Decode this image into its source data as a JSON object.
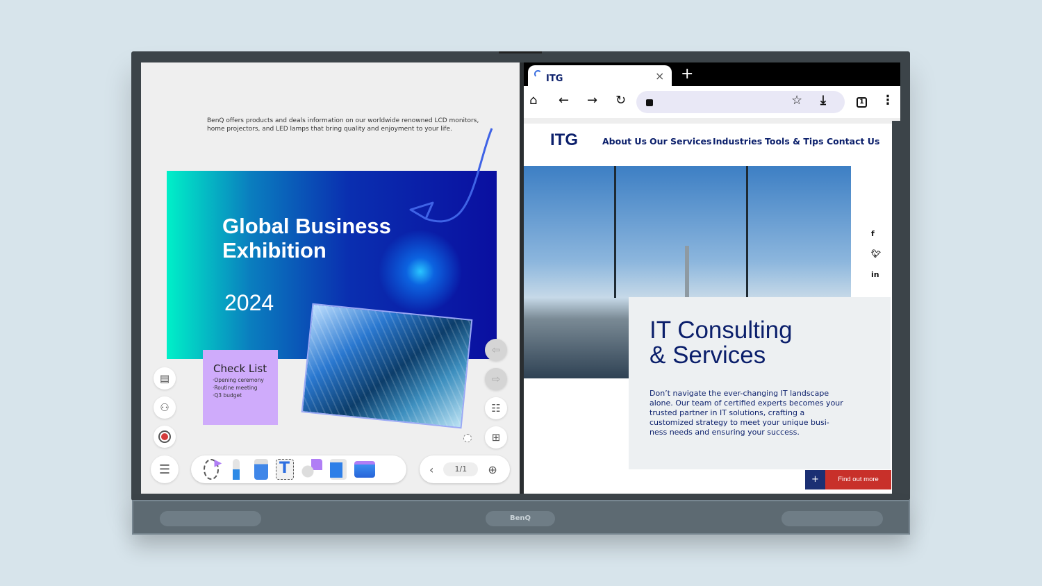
{
  "device": {
    "brand": "BenQ"
  },
  "whiteboard": {
    "intro": "BenQ offers products and deals information on our worldwide renowned LCD monitors, home projectors, and LED lamps that bring quality and enjoyment to your life.",
    "banner_title": "Global Business Exhibition",
    "banner_year": "2024",
    "sticky_title": "Check List",
    "sticky_items": [
      "·Opening ceremony",
      "·Routine meeting",
      "·Q3 budget"
    ],
    "page_indicator": "1/1",
    "left_icons": [
      "clipboard-icon",
      "add-user-icon",
      "record-icon"
    ],
    "right_icons": [
      "undo-icon",
      "redo-icon",
      "settings-panel-icon",
      "page-zoom-icon"
    ],
    "tools": [
      "lasso-select-icon",
      "pen-icon",
      "eraser-icon",
      "text-icon",
      "shapes-icon",
      "image-icon",
      "toolbox-icon"
    ]
  },
  "browser": {
    "tab_title": "ITG",
    "close": "×",
    "new_tab": "+",
    "tab_count": "1"
  },
  "site": {
    "logo": "ITG",
    "nav": [
      "About Us",
      "Our Services",
      "Industries",
      "Tools & Tips",
      "Contact Us"
    ],
    "social": [
      "f",
      "t",
      "in"
    ],
    "headline_1": "IT Consulting",
    "headline_2": "& Services",
    "body": "Don’t navigate the ever-changing IT landscape alone. Our team of certified experts becomes your trusted partner in IT solutions, crafting a customized strategy to meet your unique busi-ness needs and ensuring your success.",
    "plus": "+",
    "cta": "Find out more",
    "colors": {
      "navy": "#0b1f6b",
      "red": "#c8302a"
    }
  }
}
